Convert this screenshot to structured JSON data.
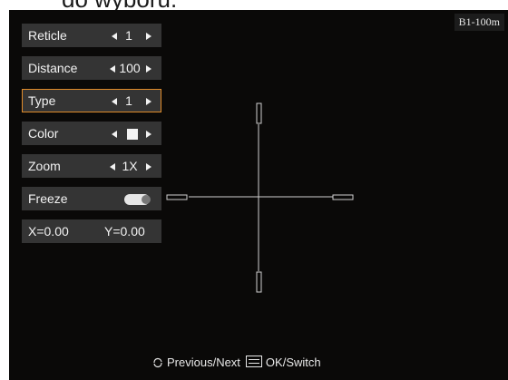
{
  "caption": "do wyboru.",
  "badge": "B1-100m",
  "menu": {
    "reticle": {
      "label": "Reticle",
      "value": "1"
    },
    "distance": {
      "label": "Distance",
      "value": "100"
    },
    "type": {
      "label": "Type",
      "value": "1"
    },
    "color": {
      "label": "Color",
      "value": "white"
    },
    "zoom": {
      "label": "Zoom",
      "value": "1X"
    },
    "freeze": {
      "label": "Freeze",
      "state": "off"
    },
    "coords": {
      "x": "X=0.00",
      "y": "Y=0.00"
    }
  },
  "footer": {
    "prev_next": "Previous/Next",
    "ok_switch": "OK/Switch"
  },
  "colors": {
    "accent": "#e08b2a",
    "menu_bg": "#343434",
    "screen_bg": "#0a0908"
  }
}
